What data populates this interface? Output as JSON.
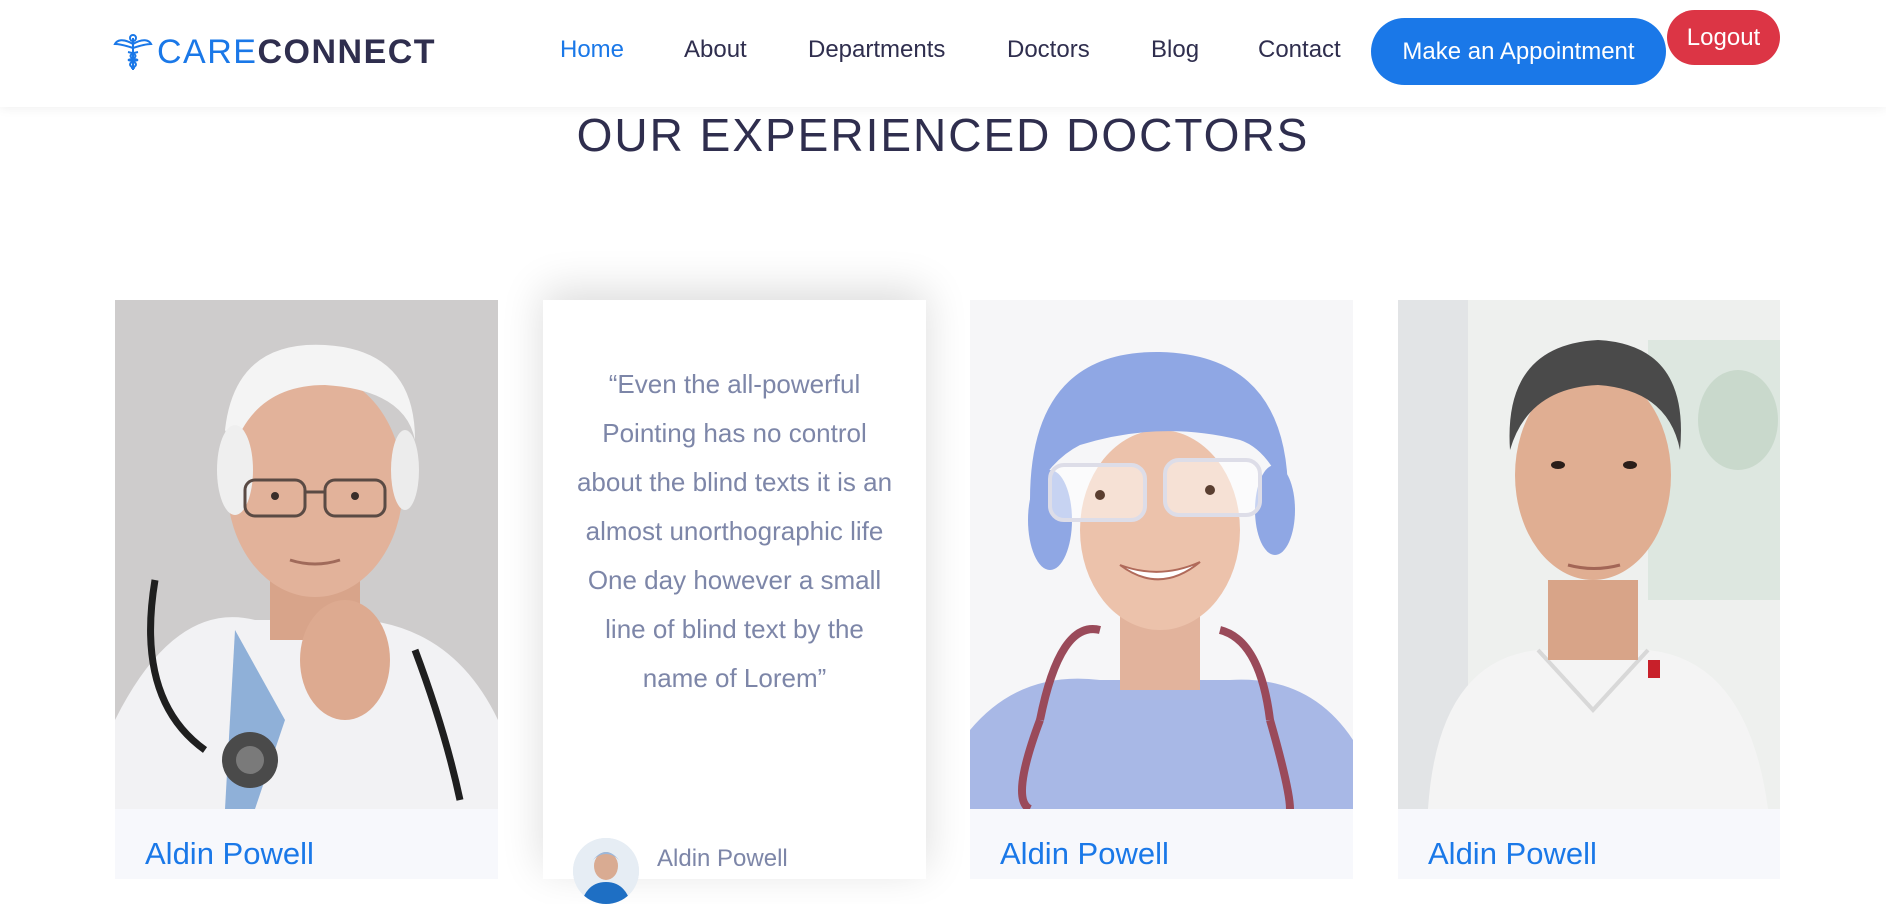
{
  "brand": {
    "part1": "CARE",
    "part2": "CONNECT",
    "color": "#1a78e8",
    "dark": "#2f2e4e"
  },
  "nav": {
    "items": [
      {
        "label": "Home",
        "active": true
      },
      {
        "label": "About"
      },
      {
        "label": "Departments"
      },
      {
        "label": "Doctors"
      },
      {
        "label": "Blog"
      },
      {
        "label": "Contact"
      }
    ],
    "appointment_button": "Make an Appointment",
    "logout_button": "Logout"
  },
  "section": {
    "title": "OUR EXPERIENCED DOCTORS"
  },
  "doctors": [
    {
      "name": "Aldin Powell"
    },
    {
      "name": "Aldin Powell"
    },
    {
      "name": "Aldin Powell"
    }
  ],
  "testimonial": {
    "quote": "“Even the all-powerful Pointing has no control about the blind texts it is an almost unorthographic life One day however a small line of blind text by the name of Lorem”",
    "author": "Aldin Powell"
  },
  "colors": {
    "accent": "#1a78e8",
    "logout": "#dc3545",
    "quote_text": "#7d86a8"
  }
}
